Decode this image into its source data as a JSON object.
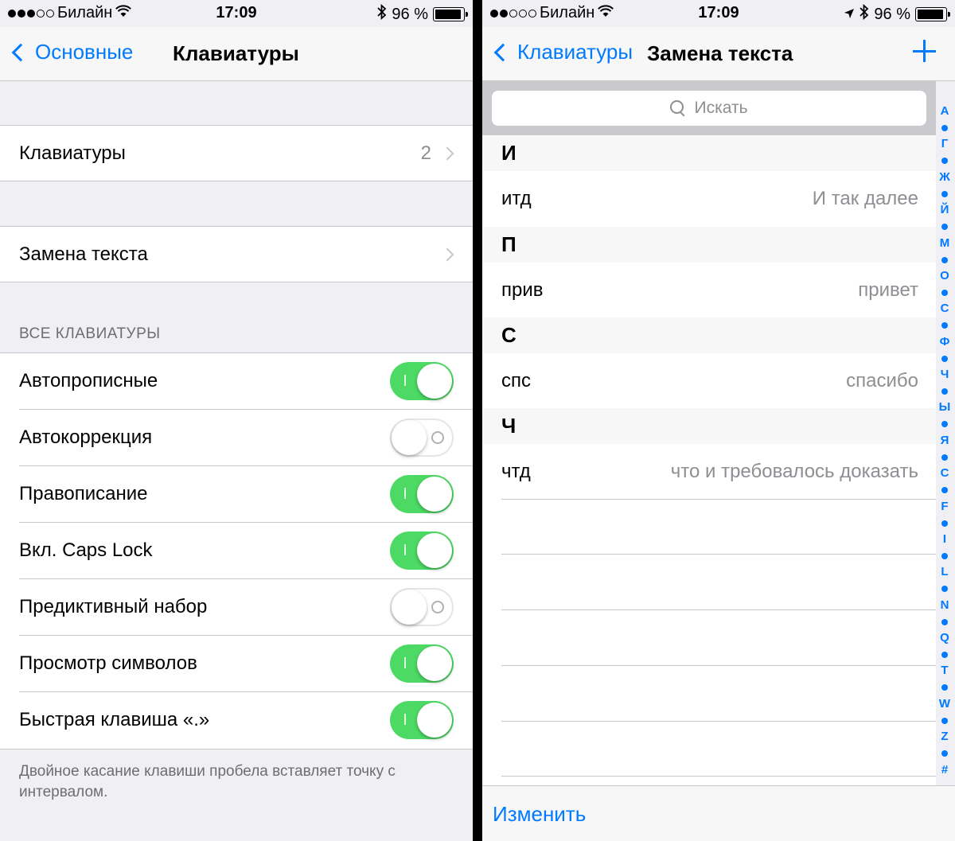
{
  "left": {
    "status": {
      "carrier": "Билайн",
      "time": "17:09",
      "battery": "96 %"
    },
    "nav": {
      "back_label": "Основные",
      "title": "Клавиатуры"
    },
    "keyboards_cell": {
      "label": "Клавиатуры",
      "value": "2"
    },
    "text_replacement_cell": {
      "label": "Замена текста"
    },
    "section_header": "ВСЕ КЛАВИАТУРЫ",
    "toggles": [
      {
        "label": "Автопрописные",
        "on": true
      },
      {
        "label": "Автокоррекция",
        "on": false
      },
      {
        "label": "Правописание",
        "on": true
      },
      {
        "label": "Вкл. Caps Lock",
        "on": true
      },
      {
        "label": "Предиктивный набор",
        "on": false
      },
      {
        "label": "Просмотр символов",
        "on": true
      },
      {
        "label": "Быстрая клавиша «.»",
        "on": true
      }
    ],
    "footer": "Двойное касание клавиши пробела вставляет точку с интервалом."
  },
  "right": {
    "status": {
      "carrier": "Билайн",
      "time": "17:09",
      "battery": "96 %"
    },
    "nav": {
      "back_label": "Клавиатуры",
      "title": "Замена текста"
    },
    "search": {
      "placeholder": "Искать"
    },
    "sections": [
      {
        "letter": "И",
        "phrase": "итд",
        "expansion": "И так далее"
      },
      {
        "letter": "П",
        "phrase": "прив",
        "expansion": "привет"
      },
      {
        "letter": "С",
        "phrase": "спс",
        "expansion": "спасибо"
      },
      {
        "letter": "Ч",
        "phrase": "чтд",
        "expansion": "что и требовалось доказать"
      }
    ],
    "index": [
      "А",
      "Г",
      "Ж",
      "Й",
      "М",
      "О",
      "С",
      "Ф",
      "Ч",
      "Ы",
      "Я",
      "C",
      "F",
      "I",
      "L",
      "N",
      "Q",
      "T",
      "W",
      "Z",
      "#"
    ],
    "toolbar": {
      "edit_label": "Изменить"
    }
  },
  "colors": {
    "accent": "#007aff",
    "toggle_on": "#4cd964",
    "background": "#efeff4"
  }
}
